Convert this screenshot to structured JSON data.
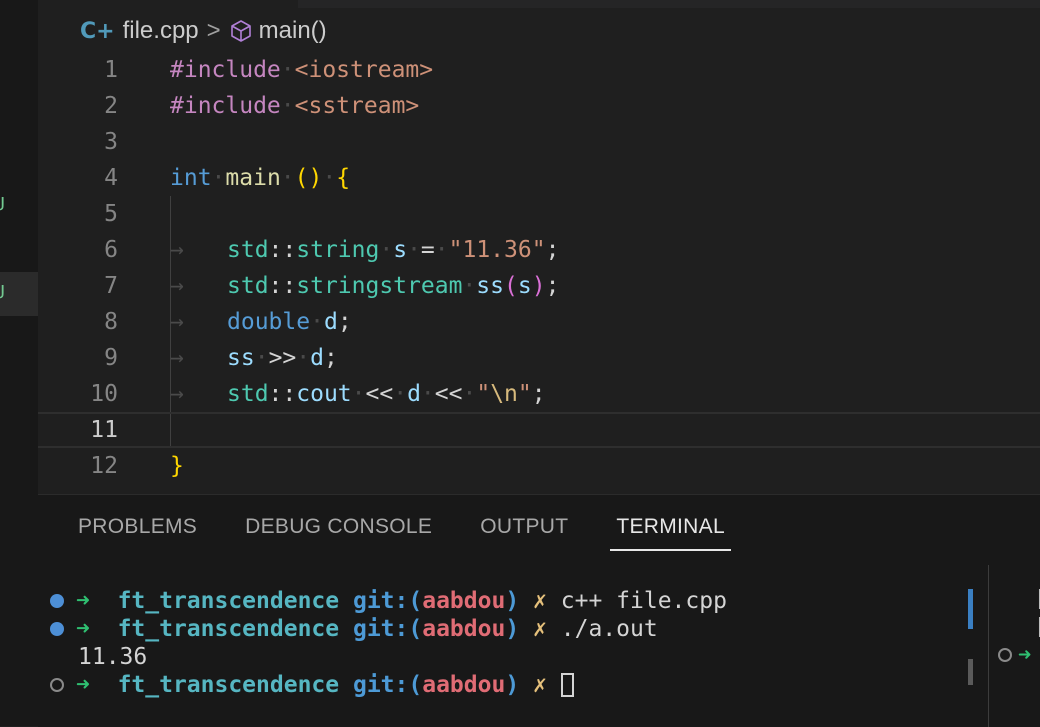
{
  "breadcrumb": {
    "file_icon": "cpp-file-icon",
    "file": "file.cpp",
    "separator": ">",
    "symbol_icon": "cube-icon",
    "symbol": "main()"
  },
  "editor": {
    "line_numbers": [
      "1",
      "2",
      "3",
      "4",
      "5",
      "6",
      "7",
      "8",
      "9",
      "10",
      "11",
      "12"
    ],
    "current_line": "11"
  },
  "panel": {
    "tabs": [
      "PROBLEMS",
      "DEBUG CONSOLE",
      "OUTPUT",
      "TERMINAL"
    ],
    "active_tab": "TERMINAL"
  },
  "terminal": {
    "prompt_dir": "ft_transcendence",
    "git_label": "git:",
    "branch_open": "(",
    "branch": "aabdou",
    "branch_close": ")",
    "dirty_mark": "✗",
    "arrow": "➜",
    "commands": [
      "c++ file.cpp",
      "./a.out"
    ],
    "output": "11.36"
  },
  "colors": {
    "background": "#1f1f1f",
    "panel_bg": "#181818",
    "keyword": "#569cd6",
    "string": "#ce9178",
    "type_ns": "#4ec9b0",
    "variable": "#9cdcfe",
    "terminal_dir": "#56b6c2",
    "terminal_branch": "#e06c75"
  }
}
